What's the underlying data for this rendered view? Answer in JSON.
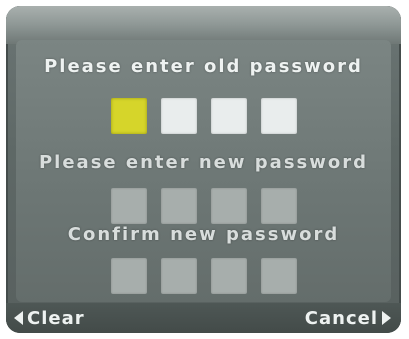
{
  "dialog": {
    "old_password": {
      "label": "Please enter old password",
      "box_count": 4,
      "active_index": 0
    },
    "new_password": {
      "label": "Please enter new password",
      "box_count": 4
    },
    "confirm_password": {
      "label": "Confirm new password",
      "box_count": 4
    }
  },
  "softkeys": {
    "left_label": "Clear",
    "left_icon": "left-arrow-icon",
    "right_label": "Cancel",
    "right_icon": "right-arrow-icon"
  },
  "colors": {
    "active_box": "#d6d52a",
    "empty_box": "#e9eded",
    "inactive_box": "#a7aeac",
    "text": "#eef2f1"
  }
}
